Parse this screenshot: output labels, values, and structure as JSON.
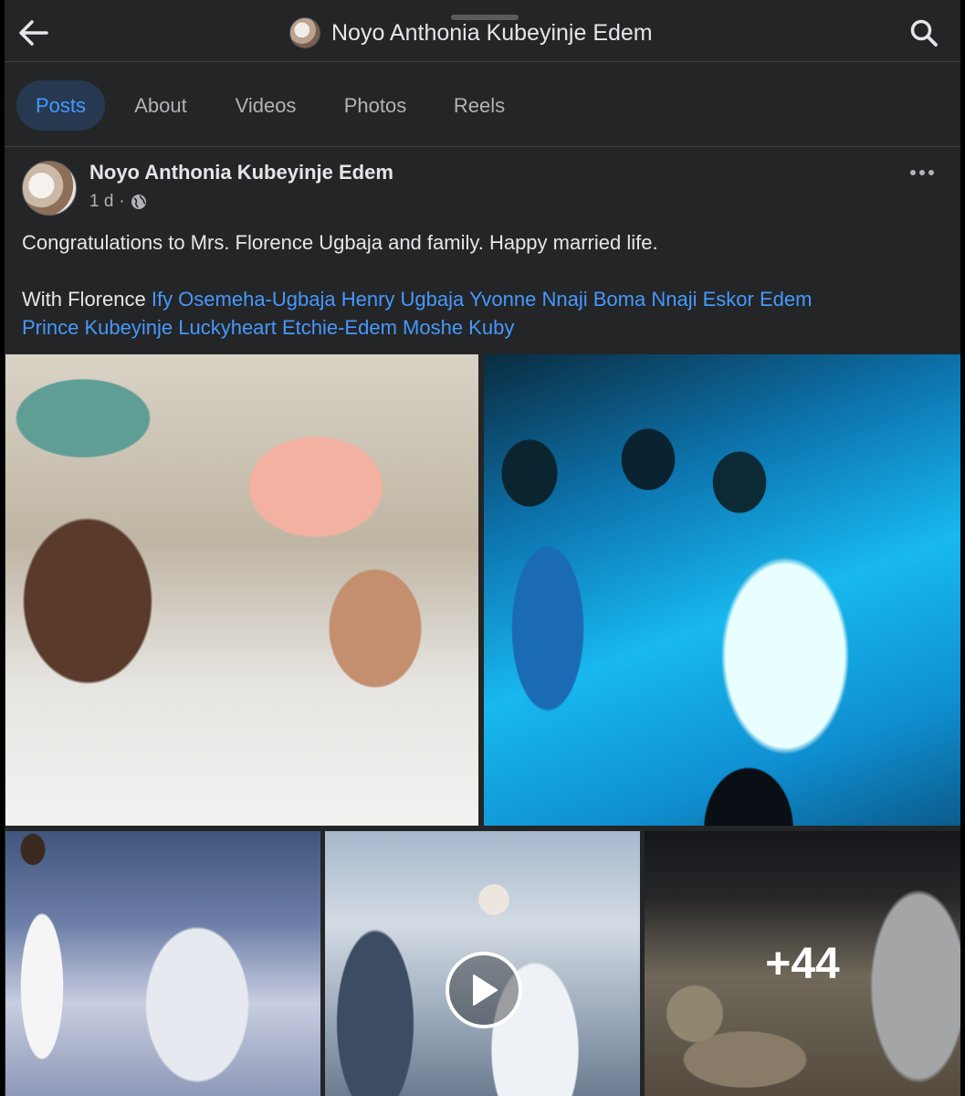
{
  "header": {
    "title": "Noyo Anthonia Kubeyinje Edem",
    "back_icon": "arrow-left-icon",
    "search_icon": "search-icon"
  },
  "tabs": [
    {
      "label": "Posts",
      "active": true
    },
    {
      "label": "About",
      "active": false
    },
    {
      "label": "Videos",
      "active": false
    },
    {
      "label": "Photos",
      "active": false
    },
    {
      "label": "Reels",
      "active": false
    }
  ],
  "post": {
    "author": "Noyo Anthonia Kubeyinje Edem",
    "time": "1 d",
    "separator": "·",
    "privacy_icon": "globe-icon",
    "message": "Congratulations to Mrs. Florence Ugbaja and family. Happy married life.",
    "with_prefix": "With Florence",
    "tagged": [
      "Ify Osemeha-Ugbaja",
      "Henry Ugbaja",
      "Yvonne Nnaji",
      "Boma Nnaji",
      "Eskor Edem",
      "Prince Kubeyinje",
      "Luckyheart Etchie-Edem",
      "Moshe Kuby"
    ],
    "more_photos_count": "+44"
  },
  "colors": {
    "background": "#242526",
    "text": "#e4e6eb",
    "secondary_text": "#b0b3b8",
    "accent": "#4599ff",
    "active_tab_bg": "#263951"
  }
}
